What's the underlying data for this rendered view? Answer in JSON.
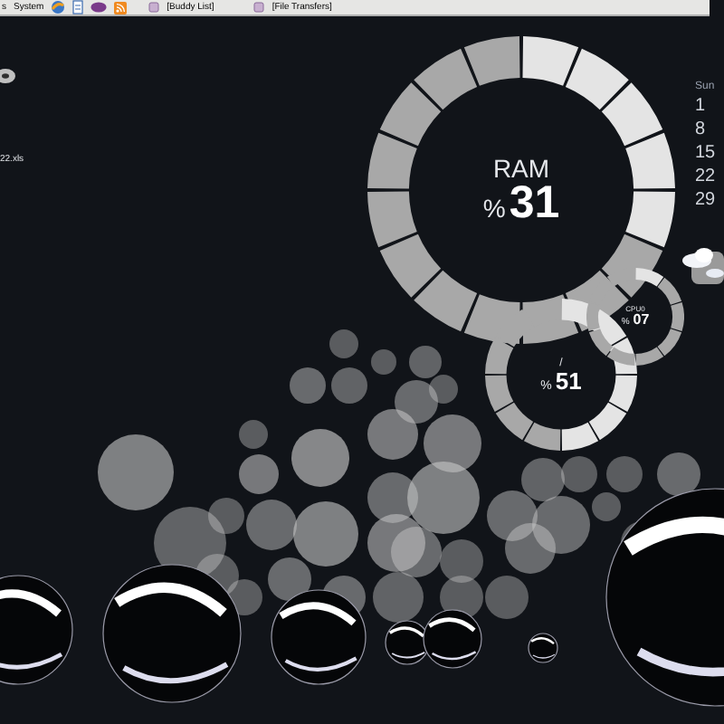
{
  "panel": {
    "menus": [
      {
        "label": "s"
      },
      {
        "label": "System"
      }
    ],
    "tasks": [
      {
        "label": "[Buddy List]"
      },
      {
        "label": "[File Transfers]"
      }
    ]
  },
  "desktop_icons": [
    {
      "label": "22.xls"
    }
  ],
  "gauges": [
    {
      "kind": "large",
      "title": "RAM",
      "unit": "%",
      "value": "31",
      "level": 0.31
    },
    {
      "kind": "medium",
      "title": "/",
      "unit": "%",
      "value": "51",
      "level": 0.5
    },
    {
      "kind": "small",
      "title": "CPU0",
      "unit": "%",
      "value": "07",
      "level": 0.07
    }
  ],
  "calendar": {
    "header": "Sun",
    "days": [
      "1",
      "8",
      "15",
      "22",
      "29"
    ]
  }
}
